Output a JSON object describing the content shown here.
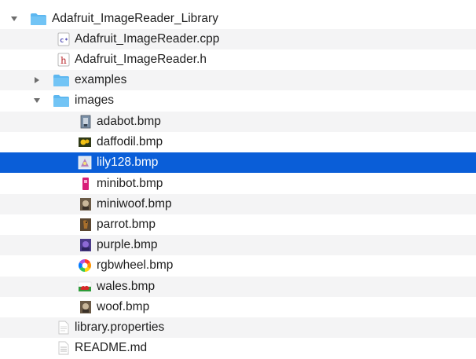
{
  "tree": {
    "root": {
      "label": "Adafruit_ImageReader_Library",
      "icon": "folder-icon",
      "expanded": true
    },
    "items": [
      {
        "id": "cpp",
        "label": "Adafruit_ImageReader.cpp",
        "icon": "cpp-file-icon",
        "glyph": "c+"
      },
      {
        "id": "h",
        "label": "Adafruit_ImageReader.h",
        "icon": "header-file-icon",
        "glyph": "h"
      },
      {
        "id": "examples",
        "label": "examples",
        "icon": "folder-icon",
        "expanded": false
      },
      {
        "id": "images",
        "label": "images",
        "icon": "folder-icon",
        "expanded": true
      },
      {
        "id": "adabot",
        "label": "adabot.bmp",
        "icon": "image-file-icon"
      },
      {
        "id": "daffodil",
        "label": "daffodil.bmp",
        "icon": "image-file-icon"
      },
      {
        "id": "lily128",
        "label": "lily128.bmp",
        "icon": "image-file-icon",
        "selected": true
      },
      {
        "id": "minibot",
        "label": "minibot.bmp",
        "icon": "image-file-icon"
      },
      {
        "id": "miniwoof",
        "label": "miniwoof.bmp",
        "icon": "image-file-icon"
      },
      {
        "id": "parrot",
        "label": "parrot.bmp",
        "icon": "image-file-icon"
      },
      {
        "id": "purple",
        "label": "purple.bmp",
        "icon": "image-file-icon"
      },
      {
        "id": "rgbwheel",
        "label": "rgbwheel.bmp",
        "icon": "image-file-icon"
      },
      {
        "id": "wales",
        "label": "wales.bmp",
        "icon": "image-file-icon"
      },
      {
        "id": "woof",
        "label": "woof.bmp",
        "icon": "image-file-icon"
      },
      {
        "id": "library",
        "label": "library.properties",
        "icon": "text-file-icon"
      },
      {
        "id": "readme",
        "label": "README.md",
        "icon": "text-file-icon"
      }
    ]
  },
  "colors": {
    "selection": "#0a5ed8",
    "folder": "#5db7f0",
    "alt_row": "#f4f4f5"
  }
}
